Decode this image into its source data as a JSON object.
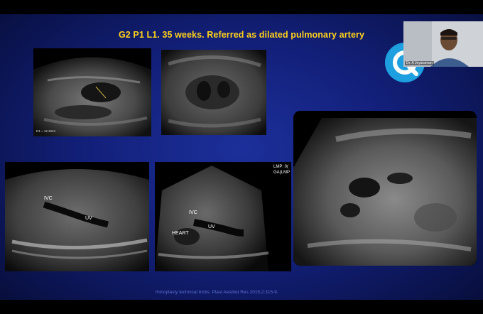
{
  "slide": {
    "title": "G2 P1 L1. 35 weeks. Referred as dilated pulmonary artery",
    "footnote": "rhinoplasty technical tricks. Plast Aesthet Res 2015;2:315-9."
  },
  "images": {
    "img1": {
      "measurement": "D1 = 12.3mm"
    },
    "img4": {
      "labels": [
        "IVC",
        "UV"
      ]
    },
    "img5": {
      "labels": [
        "LMP: 0(",
        "GA(LMP",
        "IVC",
        "HEART",
        "UV"
      ]
    }
  },
  "webcam": {
    "name": "Dr. A Jeyaraman"
  },
  "colors": {
    "title": "#ffd21a",
    "background": "#13207a",
    "logo": "#1d9fe0"
  }
}
